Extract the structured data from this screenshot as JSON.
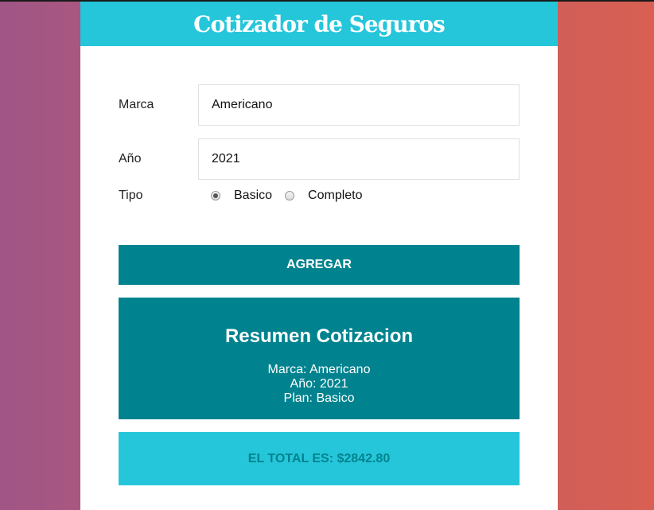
{
  "header": {
    "title": "Cotizador de Seguros"
  },
  "form": {
    "marca_label": "Marca",
    "marca_value": "Americano",
    "anio_label": "Año",
    "anio_value": "2021",
    "tipo_label": "Tipo",
    "tipo_options": [
      {
        "label": "Basico",
        "checked": true
      },
      {
        "label": "Completo",
        "checked": false
      }
    ],
    "submit_label": "Agregar"
  },
  "resumen": {
    "title": "Resumen Cotizacion",
    "marca": "Marca: Americano",
    "anio": "Año: 2021",
    "plan": "Plan: Basico"
  },
  "total": {
    "text": "EL TOTAL ES: $2842.80"
  },
  "colors": {
    "header_bg": "#26c6da",
    "primary": "#00838f",
    "bg_left": "#a05586",
    "bg_right": "#d85f52"
  }
}
